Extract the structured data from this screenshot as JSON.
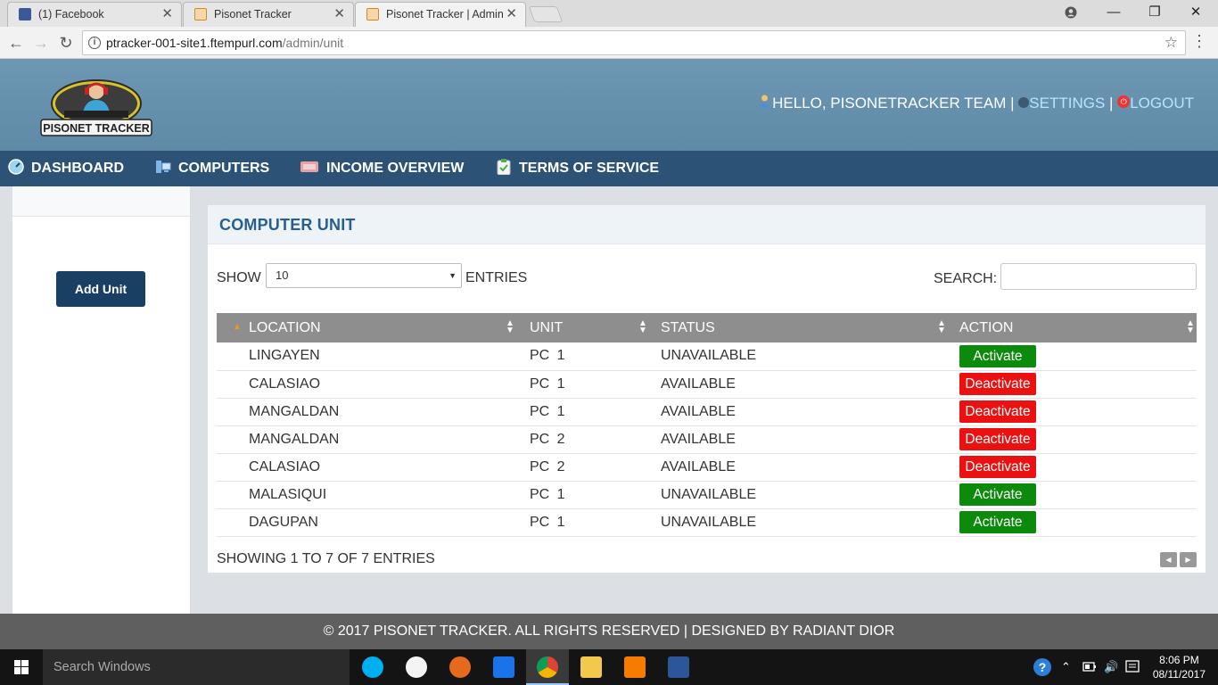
{
  "browser": {
    "tabs": [
      {
        "title": "(1) Facebook",
        "active": false
      },
      {
        "title": "Pisonet Tracker",
        "active": false
      },
      {
        "title": "Pisonet Tracker | Admin",
        "active": true
      }
    ],
    "url_host": "ptracker-001-site1.ftempurl.com",
    "url_path": "/admin/unit"
  },
  "header": {
    "logo_text": "PISONET TRACKER",
    "greeting": "HELLO, PISONETRACKER TEAM",
    "separator": "|",
    "settings_label": "SETTINGS",
    "logout_label": "LOGOUT"
  },
  "nav": {
    "items": [
      {
        "label": "DASHBOARD",
        "icon": "dashboard-icon"
      },
      {
        "label": "COMPUTERS",
        "icon": "computers-icon"
      },
      {
        "label": "INCOME OVERVIEW",
        "icon": "income-icon"
      },
      {
        "label": "TERMS OF SERVICE",
        "icon": "clipboard-icon"
      }
    ]
  },
  "sidebar": {
    "add_unit_label": "Add Unit"
  },
  "panel": {
    "title": "COMPUTER UNIT",
    "show_label": "SHOW",
    "entries_value": "10",
    "entries_label": "ENTRIES",
    "search_label": "SEARCH:",
    "search_value": "",
    "columns": [
      "LOCATION",
      "UNIT",
      "STATUS",
      "ACTION"
    ],
    "rows": [
      {
        "location": "LINGAYEN",
        "unit": "PC 1",
        "status": "UNAVAILABLE",
        "action": "Activate"
      },
      {
        "location": "CALASIAO",
        "unit": "PC 1",
        "status": "AVAILABLE",
        "action": "Deactivate"
      },
      {
        "location": "MANGALDAN",
        "unit": "PC 1",
        "status": "AVAILABLE",
        "action": "Deactivate"
      },
      {
        "location": "MANGALDAN",
        "unit": "PC 2",
        "status": "AVAILABLE",
        "action": "Deactivate"
      },
      {
        "location": "CALASIAO",
        "unit": "PC 2",
        "status": "AVAILABLE",
        "action": "Deactivate"
      },
      {
        "location": "MALASIQUI",
        "unit": "PC 1",
        "status": "UNAVAILABLE",
        "action": "Activate"
      },
      {
        "location": "DAGUPAN",
        "unit": "PC 1",
        "status": "UNAVAILABLE",
        "action": "Activate"
      }
    ],
    "showing_text": "SHOWING 1 TO 7 OF 7 ENTRIES"
  },
  "footer": {
    "text": "© 2017 PISONET TRACKER. ALL RIGHTS RESERVED | DESIGNED BY RADIANT DIOR"
  },
  "taskbar": {
    "search_placeholder": "Search Windows",
    "time": "8:06 PM",
    "date": "08/11/2017"
  },
  "colors": {
    "header_bg": "#6d97b3",
    "nav_bg": "#2c5275",
    "title_blue": "#2a5f8d",
    "activate_green": "#0b8a0b",
    "deactivate_red": "#ec1111",
    "button_navy": "#193f63"
  }
}
